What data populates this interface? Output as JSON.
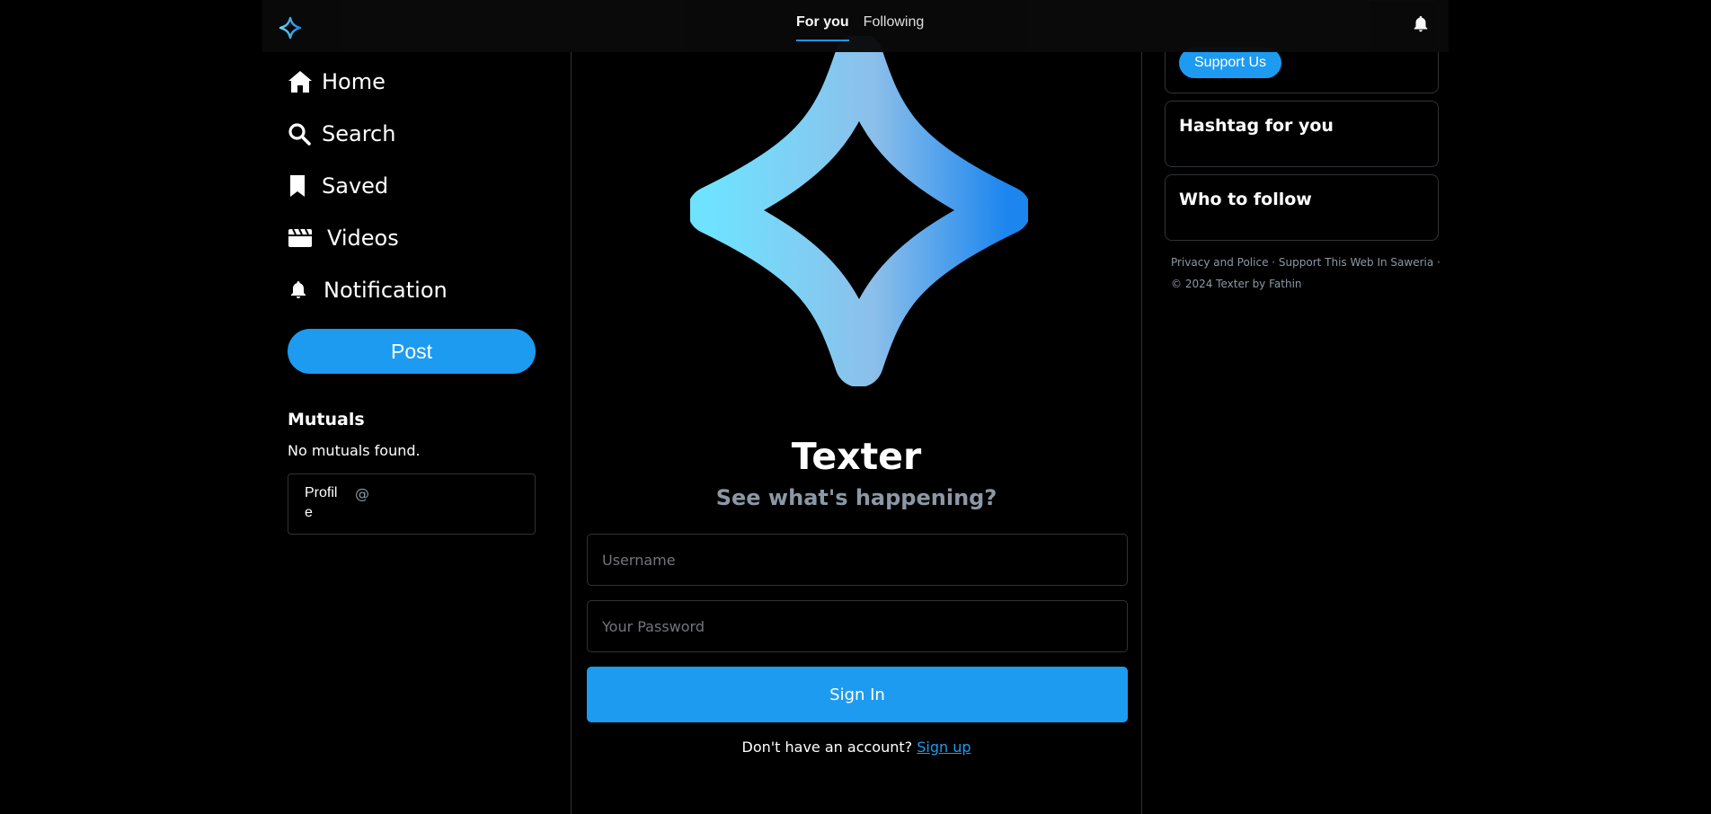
{
  "topbar": {
    "tabs": [
      {
        "label": "For you",
        "active": true
      },
      {
        "label": "Following",
        "active": false
      }
    ]
  },
  "sidebar": {
    "items": [
      {
        "label": "Home",
        "icon": "home-icon"
      },
      {
        "label": "Search",
        "icon": "search-icon"
      },
      {
        "label": "Saved",
        "icon": "bookmark-icon"
      },
      {
        "label": "Videos",
        "icon": "clapperboard-icon"
      },
      {
        "label": "Notification",
        "icon": "bell-icon"
      }
    ],
    "post_label": "Post",
    "mutuals": {
      "title": "Mutuals",
      "empty_text": "No mutuals found.",
      "card": {
        "pic_alt": "Profile",
        "handle": "@"
      }
    }
  },
  "main": {
    "title": "Texter",
    "subtitle": "See what's happening?",
    "username_placeholder": "Username",
    "password_placeholder": "Your Password",
    "signin_label": "Sign In",
    "signup_prompt": "Don't have an account?",
    "signup_link": "Sign up"
  },
  "right": {
    "support_label": "Support Us",
    "hashtag_title": "Hashtag for you",
    "follow_title": "Who to follow",
    "footer": {
      "privacy": "Privacy and Police",
      "support_link": "Support This Web In Saweria",
      "copyright": "© 2024 Texter by Fathin"
    }
  },
  "colors": {
    "accent": "#1d9bf0",
    "background": "#000000",
    "border": "#2f3336",
    "star_gradient_start": "#6fe2ff",
    "star_gradient_end": "#1c86ee"
  }
}
